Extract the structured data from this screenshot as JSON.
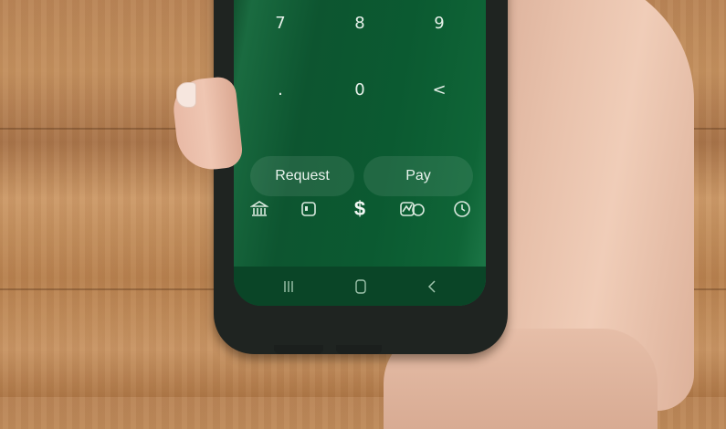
{
  "keypad": {
    "row1": [
      "7",
      "8",
      "9"
    ],
    "row2": [
      ".",
      "0",
      "<"
    ]
  },
  "actions": {
    "request_label": "Request",
    "pay_label": "Pay"
  },
  "tabbar": {
    "icons": [
      "bank-icon",
      "card-icon",
      "dollar-icon",
      "activity-icon",
      "clock-icon"
    ],
    "dollar_glyph": "$"
  },
  "system_nav": {
    "icons": [
      "recents-icon",
      "home-icon",
      "back-icon"
    ]
  },
  "colors": {
    "screen_green": "#0b5a31",
    "case": "#1f2421",
    "wood": "#c3905f"
  }
}
